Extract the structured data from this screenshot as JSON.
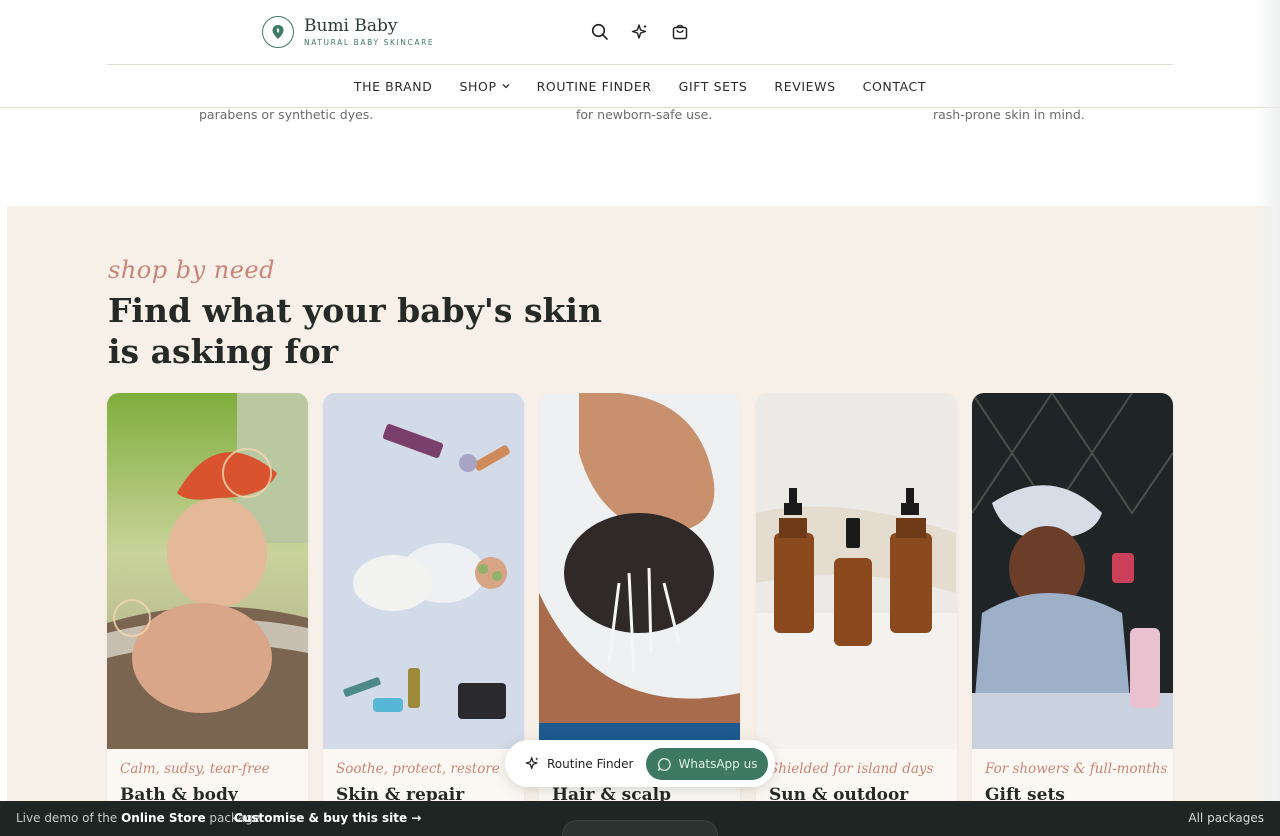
{
  "header": {
    "brand_name": "Bumi Baby",
    "brand_tagline": "NATURAL BABY SKINCARE",
    "icons": [
      "search-icon",
      "sparkle-icon",
      "bag-icon"
    ]
  },
  "nav": {
    "items": [
      {
        "label": "THE BRAND"
      },
      {
        "label": "SHOP"
      },
      {
        "label": "ROUTINE FINDER"
      },
      {
        "label": "GIFT SETS"
      },
      {
        "label": "REVIEWS"
      },
      {
        "label": "CONTACT"
      }
    ]
  },
  "features": {
    "items": [
      {
        "text": "parabens or synthetic dyes."
      },
      {
        "text": "for newborn-safe use."
      },
      {
        "text": "rash-prone skin in mind."
      }
    ]
  },
  "shop": {
    "eyebrow": "shop by need",
    "heading": "Find what your baby's skin is asking for",
    "cards": [
      {
        "kicker": "Calm, sudsy, tear-free",
        "title": "Bath & body"
      },
      {
        "kicker": "Soothe, protect, restore",
        "title": "Skin & repair"
      },
      {
        "kicker": "",
        "title": "Hair & scalp"
      },
      {
        "kicker": "Shielded for island days",
        "title": "Sun & outdoor"
      },
      {
        "kicker": "For showers & full-months",
        "title": "Gift sets"
      }
    ]
  },
  "pill": {
    "finder_label": "Routine Finder",
    "whatsapp_label": "WhatsApp us"
  },
  "bottombar": {
    "prefix": "Live demo of the",
    "package_name": "Online Store",
    "suffix": "package.",
    "cta": "Customise & buy this site →",
    "right": "All packages"
  },
  "colors": {
    "accent_green": "#3c7862",
    "eyebrow_pink": "#c9857a",
    "section_bg": "#f6f0e8",
    "bar_bg": "#1e2522"
  }
}
